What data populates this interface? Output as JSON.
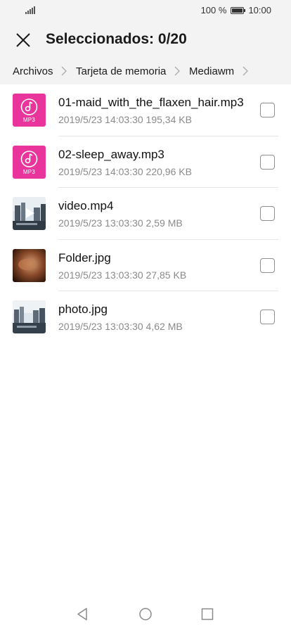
{
  "status": {
    "battery_text": "100 %",
    "time": "10:00"
  },
  "appbar": {
    "title": "Seleccionados: 0/20"
  },
  "breadcrumb": {
    "items": [
      "Archivos",
      "Tarjeta de memoria",
      "Mediawm"
    ]
  },
  "files": [
    {
      "name": "01-maid_with_the_flaxen_hair.mp3",
      "meta": "2019/5/23 14:03:30 195,34 KB",
      "thumb_label": "MP3",
      "kind": "audio",
      "checked": false
    },
    {
      "name": "02-sleep_away.mp3",
      "meta": "2019/5/23 14:03:30 220,96 KB",
      "thumb_label": "MP3",
      "kind": "audio",
      "checked": false
    },
    {
      "name": "video.mp4",
      "meta": "2019/5/23 13:03:30 2,59 MB",
      "kind": "video",
      "checked": false
    },
    {
      "name": "Folder.jpg",
      "meta": "2019/5/23 13:03:30 27,85 KB",
      "kind": "image",
      "checked": false
    },
    {
      "name": "photo.jpg",
      "meta": "2019/5/23 13:03:30 4,62 MB",
      "kind": "image",
      "checked": false
    }
  ],
  "colors": {
    "mp3_thumb": "#e8349b",
    "header_bg": "#f3f3f3"
  },
  "icons": {
    "close": "close-icon",
    "breadcrumb_sep": "chevron-right-icon",
    "nav_back": "triangle-back-icon",
    "nav_home": "circle-home-icon",
    "nav_recents": "square-recents-icon"
  }
}
